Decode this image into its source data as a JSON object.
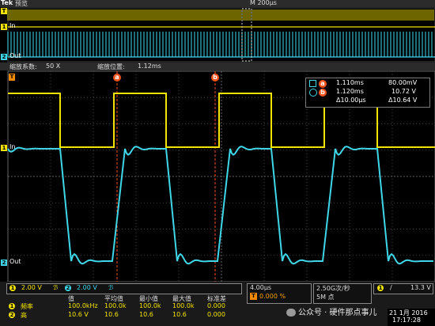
{
  "brand": "Tek",
  "preview_label": "预览",
  "timebase_top": "M 200μs",
  "zoom_factor_label": "缩放系数:",
  "zoom_factor": "50 X",
  "zoom_pos_label": "缩放位置:",
  "zoom_pos": "1.12ms",
  "channels": {
    "ch1": {
      "number": "1",
      "name": "In",
      "color": "#f2e300"
    },
    "ch2": {
      "number": "2",
      "name": "Out",
      "color": "#3fd6e8"
    }
  },
  "trigger_marker": "T",
  "cursor_a_label": "a",
  "cursor_b_label": "b",
  "cursor_readout": {
    "a_time": "1.110ms",
    "a_value": "80.00mV",
    "b_time": "1.120ms",
    "b_value": "10.72 V",
    "dt": "Δ10.00μs",
    "dv": "Δ10.64 V"
  },
  "scale": {
    "ch1": "2.00 V",
    "ch2": "2.00 V",
    "bw_symbol": "ℬ",
    "time_div": "4.00μs",
    "time_offset": "0.000 %",
    "sample_rate": "2.50G次/秒",
    "record": "5M 点",
    "trig_slope": "/",
    "trig_level": "13.3 V"
  },
  "measure": {
    "headers": [
      "值",
      "平均值",
      "最小值",
      "最大值",
      "标准差"
    ],
    "rows": [
      {
        "ch": "1",
        "name": "频率",
        "values": [
          "100.0kHz",
          "100.0k",
          "100.0k",
          "100.0k",
          "0.000"
        ]
      },
      {
        "ch": "2",
        "name": "高",
        "values": [
          "10.6 V",
          "10.6",
          "10.6",
          "10.6",
          "0.000"
        ]
      }
    ]
  },
  "datetime": {
    "date": "21 1月 2016",
    "time": "17:17:28"
  },
  "watermark": "公众号 · 硬件那点事儿"
}
